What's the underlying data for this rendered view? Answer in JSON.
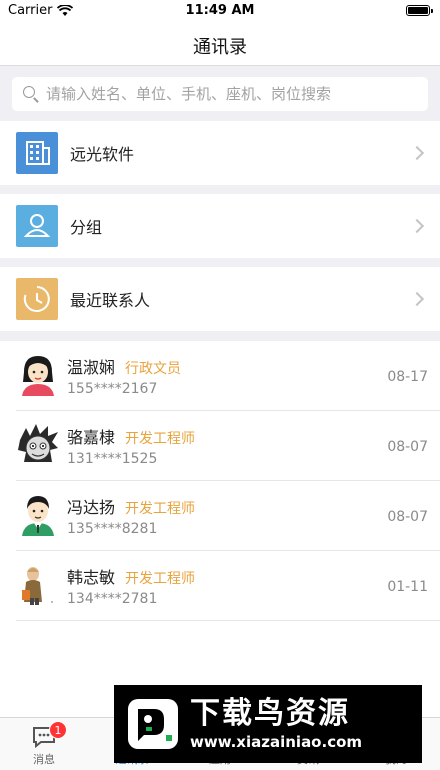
{
  "status_bar": {
    "carrier": "Carrier",
    "time": "11:49 AM"
  },
  "nav": {
    "title": "通讯录"
  },
  "search": {
    "placeholder": "请输入姓名、单位、手机、座机、岗位搜索"
  },
  "menu": [
    {
      "label": "远光软件",
      "icon": "building-icon",
      "color": "#4a90d9"
    },
    {
      "label": "分组",
      "icon": "group-icon",
      "color": "#5aaee0"
    },
    {
      "label": "最近联系人",
      "icon": "clock-icon",
      "color": "#e9b86a"
    }
  ],
  "contacts": [
    {
      "name": "温淑娴",
      "role": "行政文员",
      "phone": "155****2167",
      "date": "08-17",
      "avatar": "female-avatar-icon"
    },
    {
      "name": "骆嘉棣",
      "role": "开发工程师",
      "phone": "131****1525",
      "date": "08-07",
      "avatar": "cartoon-avatar-icon"
    },
    {
      "name": "冯达扬",
      "role": "开发工程师",
      "phone": "135****8281",
      "date": "08-07",
      "avatar": "male-avatar-icon"
    },
    {
      "name": "韩志敏",
      "role": "开发工程师",
      "phone": "134****2781",
      "date": "01-11",
      "avatar": "photo-avatar-icon"
    }
  ],
  "tabs": [
    {
      "label": "消息",
      "icon": "chat-icon",
      "badge": "1"
    },
    {
      "label": "通讯录",
      "icon": "contacts-icon",
      "active": true
    },
    {
      "label": "应用",
      "icon": "apps-icon"
    },
    {
      "label": "资讯",
      "icon": "news-icon"
    },
    {
      "label": "我的",
      "icon": "profile-icon"
    }
  ],
  "watermark": {
    "title": "下载鸟资源",
    "url": "www.xiazainiao.com"
  },
  "colors": {
    "accent": "#2f86d6",
    "role": "#e8a33d",
    "badge": "#ff3333"
  }
}
